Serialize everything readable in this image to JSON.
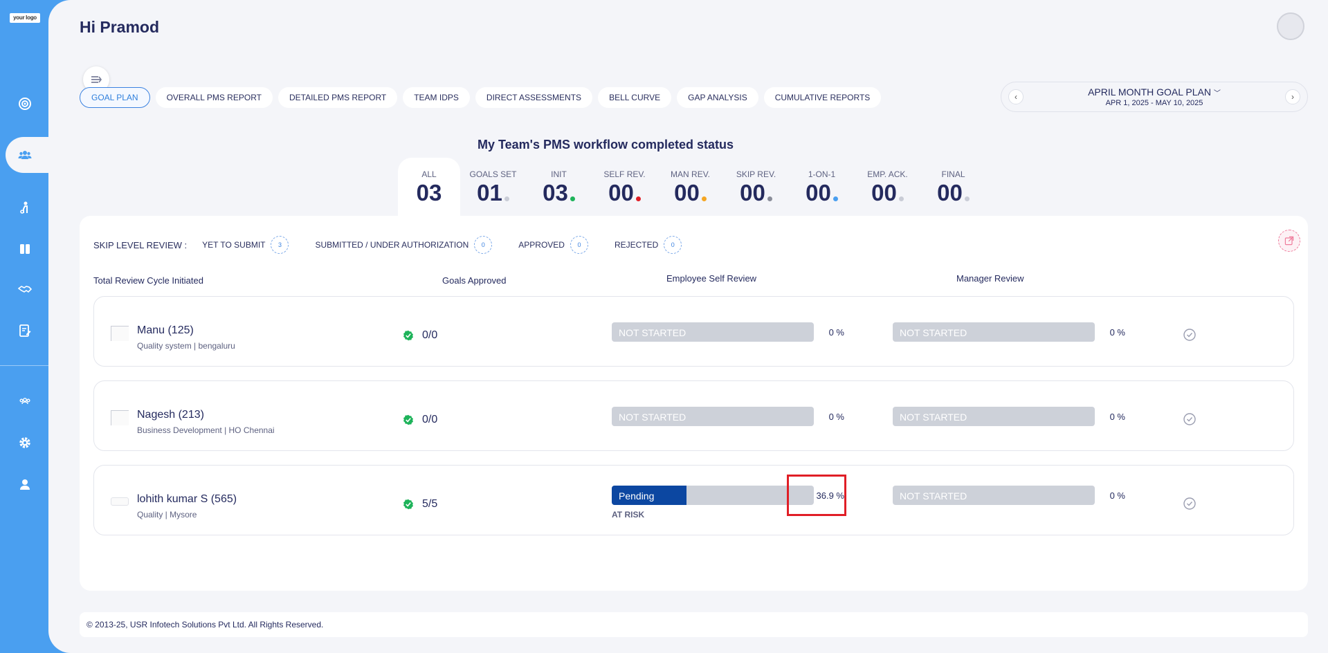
{
  "brand": {
    "logo_text": "your logo"
  },
  "sidebar": {
    "icons": [
      "goal-icon",
      "team-icon",
      "person-icon",
      "book-icon",
      "handshake-icon",
      "report-icon",
      "group-icon",
      "gear-icon",
      "user-icon"
    ]
  },
  "header": {
    "greeting": "Hi Pramod"
  },
  "tabs": [
    {
      "label": "GOAL PLAN",
      "active": true
    },
    {
      "label": "OVERALL PMS REPORT"
    },
    {
      "label": "DETAILED PMS REPORT"
    },
    {
      "label": "TEAM IDPS"
    },
    {
      "label": "DIRECT ASSESSMENTS"
    },
    {
      "label": "BELL CURVE"
    },
    {
      "label": "GAP ANALYSIS"
    },
    {
      "label": "CUMULATIVE REPORTS"
    }
  ],
  "period": {
    "title": "APRIL MONTH GOAL PLAN",
    "dates": "APR 1, 2025 - MAY 10, 2025"
  },
  "status": {
    "title": "My Team's PMS workflow completed status",
    "items": [
      {
        "label": "ALL",
        "value": "03",
        "dot": ""
      },
      {
        "label": "GOALS SET",
        "value": "01",
        "dot": "#c9ccd6"
      },
      {
        "label": "INIT",
        "value": "03",
        "dot": "#1eb35a"
      },
      {
        "label": "SELF REV.",
        "value": "00",
        "dot": "#e01e26"
      },
      {
        "label": "MAN REV.",
        "value": "00",
        "dot": "#f5a623"
      },
      {
        "label": "SKIP REV.",
        "value": "00",
        "dot": "#8a8d99"
      },
      {
        "label": "1-ON-1",
        "value": "00",
        "dot": "#4a9ff0"
      },
      {
        "label": "EMP. ACK.",
        "value": "00",
        "dot": "#c9ccd6"
      },
      {
        "label": "FINAL",
        "value": "00",
        "dot": "#c9ccd6"
      }
    ]
  },
  "skip_level": {
    "heading": "SKIP LEVEL REVIEW :",
    "items": [
      {
        "label": "YET TO SUBMIT",
        "count": "3"
      },
      {
        "label": "SUBMITTED / UNDER AUTHORIZATION",
        "count": "0"
      },
      {
        "label": "APPROVED",
        "count": "0"
      },
      {
        "label": "REJECTED",
        "count": "0"
      }
    ]
  },
  "columns": {
    "cycle": "Total Review Cycle Initiated",
    "goals": "Goals Approved",
    "self": "Employee Self Review",
    "manager": "Manager Review"
  },
  "rows": [
    {
      "name": "Manu (125)",
      "meta": "Quality system | bengaluru",
      "goals": "0/0",
      "self_status": "NOT STARTED",
      "self_progress": 0,
      "self_pct": "0 %",
      "mgr_status": "NOT STARTED",
      "mgr_pct": "0 %",
      "risk": ""
    },
    {
      "name": "Nagesh (213)",
      "meta": "Business Development | HO Chennai",
      "goals": "0/0",
      "self_status": "NOT STARTED",
      "self_progress": 0,
      "self_pct": "0 %",
      "mgr_status": "NOT STARTED",
      "mgr_pct": "0 %",
      "risk": ""
    },
    {
      "name": "lohith kumar S (565)",
      "meta": "Quality | Mysore",
      "goals": "5/5",
      "self_status": "Pending",
      "self_progress": 36.9,
      "self_pct": "36.9 %",
      "mgr_status": "NOT STARTED",
      "mgr_pct": "0 %",
      "risk": "AT RISK"
    }
  ],
  "footer": {
    "text": "© 2013-25, USR Infotech Solutions Pvt Ltd. All Rights Reserved."
  },
  "colors": {
    "sidebar": "#4a9ff0",
    "accent": "#2f7fdc",
    "progress": "#0c47a1",
    "highlight": "#e01e26",
    "approved": "#1eb35a"
  }
}
